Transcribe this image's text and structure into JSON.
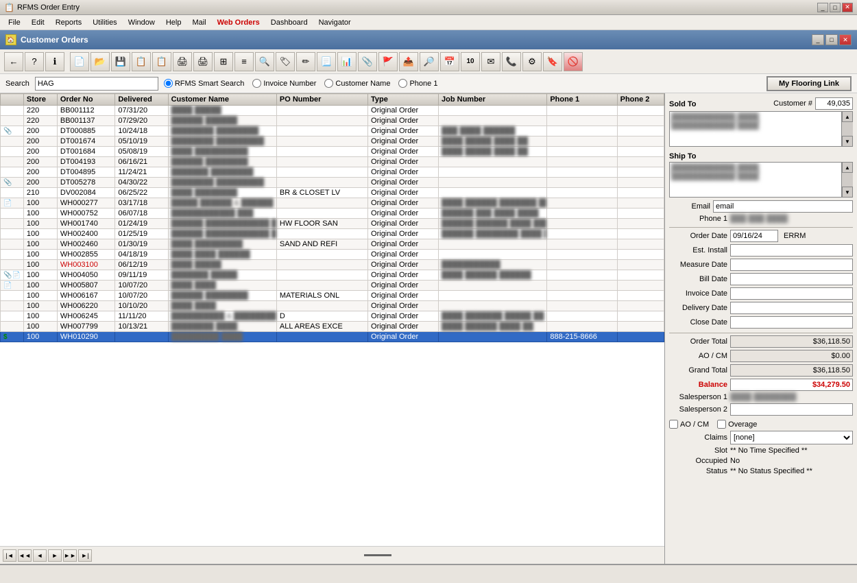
{
  "titleBar": {
    "title": "RFMS Order Entry",
    "buttons": [
      "_",
      "□",
      "✕"
    ]
  },
  "menuBar": {
    "items": [
      {
        "label": "File",
        "highlight": false
      },
      {
        "label": "Edit",
        "highlight": false
      },
      {
        "label": "Reports",
        "highlight": false
      },
      {
        "label": "Utilities",
        "highlight": false
      },
      {
        "label": "Window",
        "highlight": false
      },
      {
        "label": "Help",
        "highlight": false
      },
      {
        "label": "Mail",
        "highlight": false
      },
      {
        "label": "Web Orders",
        "highlight": true
      },
      {
        "label": "Dashboard",
        "highlight": false
      },
      {
        "label": "Navigator",
        "highlight": false
      }
    ]
  },
  "appTitleBar": {
    "title": "Customer Orders",
    "buttons": [
      "_",
      "□",
      "✕"
    ]
  },
  "search": {
    "label": "Search",
    "value": "HAG",
    "placeholder": "",
    "radioOptions": [
      {
        "label": "RFMS Smart Search",
        "checked": true
      },
      {
        "label": "Invoice Number",
        "checked": false
      },
      {
        "label": "Customer Name",
        "checked": false
      },
      {
        "label": "Phone 1",
        "checked": false
      }
    ],
    "myFlooringBtn": "My Flooring Link"
  },
  "grid": {
    "columns": [
      "",
      "Store",
      "Order No",
      "Delivered",
      "Customer Name",
      "PO Number",
      "Type",
      "Job Number",
      "Phone 1",
      "Phone 2"
    ],
    "rows": [
      {
        "icons": "",
        "store": "220",
        "orderNo": "BB001112",
        "delivered": "07/31/20",
        "customer": "████ █████",
        "po": "",
        "type": "Original Order",
        "job": "",
        "phone1": "",
        "phone2": "",
        "selected": false,
        "red": false
      },
      {
        "icons": "",
        "store": "220",
        "orderNo": "BB001137",
        "delivered": "07/29/20",
        "customer": "██████ ██████",
        "po": "",
        "type": "Original Order",
        "job": "",
        "phone1": "",
        "phone2": "",
        "selected": false,
        "red": false
      },
      {
        "icons": "📎",
        "store": "200",
        "orderNo": "DT000885",
        "delivered": "10/24/18",
        "customer": "████████ ████████",
        "po": "",
        "type": "Original Order",
        "job": "███ ████ ██████",
        "phone1": "",
        "phone2": "",
        "selected": false,
        "red": false
      },
      {
        "icons": "",
        "store": "200",
        "orderNo": "DT001674",
        "delivered": "05/10/19",
        "customer": "████████ █████████",
        "po": "",
        "type": "Original Order",
        "job": "████ █████ ████ ██",
        "phone1": "",
        "phone2": "",
        "selected": false,
        "red": false
      },
      {
        "icons": "",
        "store": "200",
        "orderNo": "DT001684",
        "delivered": "05/08/19",
        "customer": "████ ██████████",
        "po": "",
        "type": "Original Order",
        "job": "████ █████ ████ ██",
        "phone1": "",
        "phone2": "",
        "selected": false,
        "red": false
      },
      {
        "icons": "",
        "store": "200",
        "orderNo": "DT004193",
        "delivered": "06/16/21",
        "customer": "██████ ████████",
        "po": "",
        "type": "Original Order",
        "job": "",
        "phone1": "",
        "phone2": "",
        "selected": false,
        "red": false
      },
      {
        "icons": "",
        "store": "200",
        "orderNo": "DT004895",
        "delivered": "11/24/21",
        "customer": "███████ ████████",
        "po": "",
        "type": "Original Order",
        "job": "",
        "phone1": "",
        "phone2": "",
        "selected": false,
        "red": false
      },
      {
        "icons": "📎",
        "store": "200",
        "orderNo": "DT005278",
        "delivered": "04/30/22",
        "customer": "████████ █████████",
        "po": "",
        "type": "Original Order",
        "job": "",
        "phone1": "",
        "phone2": "",
        "selected": false,
        "red": false
      },
      {
        "icons": "",
        "store": "210",
        "orderNo": "DV002084",
        "delivered": "06/25/22",
        "customer": "████ ████████",
        "po": "BR & CLOSET LV",
        "type": "Original Order",
        "job": "",
        "phone1": "",
        "phone2": "",
        "selected": false,
        "red": false
      },
      {
        "icons": "📄",
        "store": "100",
        "orderNo": "WH000277",
        "delivered": "03/17/18",
        "customer": "█████ ██████ & ██████",
        "po": "",
        "type": "Original Order",
        "job": "████ ██████ ███████ ██",
        "phone1": "",
        "phone2": "",
        "selected": false,
        "red": false
      },
      {
        "icons": "",
        "store": "100",
        "orderNo": "WH000752",
        "delivered": "06/07/18",
        "customer": "████████████ ███",
        "po": "",
        "type": "Original Order",
        "job": "██████ ███ ████ ████",
        "phone1": "",
        "phone2": "",
        "selected": false,
        "red": false
      },
      {
        "icons": "",
        "store": "100",
        "orderNo": "WH001740",
        "delivered": "01/24/19",
        "customer": "██████ ████████████ ██",
        "po": "HW FLOOR SAN",
        "type": "Original Order",
        "job": "██████ ██████ ████ ████",
        "phone1": "",
        "phone2": "",
        "selected": false,
        "red": false
      },
      {
        "icons": "",
        "store": "100",
        "orderNo": "WH002400",
        "delivered": "01/25/19",
        "customer": "██████ ████████████ ██",
        "po": "",
        "type": "Original Order",
        "job": "██████ ████████ ████ ████",
        "phone1": "",
        "phone2": "",
        "selected": false,
        "red": false
      },
      {
        "icons": "",
        "store": "100",
        "orderNo": "WH002460",
        "delivered": "01/30/19",
        "customer": "████ █████████",
        "po": "SAND AND REFI",
        "type": "Original Order",
        "job": "",
        "phone1": "",
        "phone2": "",
        "selected": false,
        "red": false
      },
      {
        "icons": "",
        "store": "100",
        "orderNo": "WH002855",
        "delivered": "04/18/19",
        "customer": "████ ████ ██████",
        "po": "",
        "type": "Original Order",
        "job": "",
        "phone1": "",
        "phone2": "",
        "selected": false,
        "red": false
      },
      {
        "icons": "",
        "store": "100",
        "orderNo": "WH003100",
        "delivered": "06/12/19",
        "customer": "████ █████",
        "po": "",
        "type": "Original Order",
        "job": "███████████",
        "phone1": "",
        "phone2": "",
        "selected": false,
        "red": true
      },
      {
        "icons": "📎📄",
        "store": "100",
        "orderNo": "WH004050",
        "delivered": "09/11/19",
        "customer": "███████ █████",
        "po": "",
        "type": "Original Order",
        "job": "████ ██████ ██████",
        "phone1": "",
        "phone2": "",
        "selected": false,
        "red": false
      },
      {
        "icons": "📄",
        "store": "100",
        "orderNo": "WH005807",
        "delivered": "10/07/20",
        "customer": "████ ████",
        "po": "",
        "type": "Original Order",
        "job": "",
        "phone1": "",
        "phone2": "",
        "selected": false,
        "red": false
      },
      {
        "icons": "",
        "store": "100",
        "orderNo": "WH006167",
        "delivered": "10/07/20",
        "customer": "██████ ████████",
        "po": "MATERIALS ONL",
        "type": "Original Order",
        "job": "",
        "phone1": "",
        "phone2": "",
        "selected": false,
        "red": false
      },
      {
        "icons": "",
        "store": "100",
        "orderNo": "WH006220",
        "delivered": "10/10/20",
        "customer": "████ ████",
        "po": "",
        "type": "Original Order",
        "job": "",
        "phone1": "",
        "phone2": "",
        "selected": false,
        "red": false
      },
      {
        "icons": "",
        "store": "100",
        "orderNo": "WH006245",
        "delivered": "11/11/20",
        "customer": "██████████ & ████████",
        "po": "D",
        "type": "Original Order",
        "job": "████ ███████ █████ ██",
        "phone1": "",
        "phone2": "",
        "selected": false,
        "red": false
      },
      {
        "icons": "",
        "store": "100",
        "orderNo": "WH007799",
        "delivered": "10/13/21",
        "customer": "████████ ████",
        "po": "ALL AREAS EXCE",
        "type": "Original Order",
        "job": "████ ██████ ████ ██",
        "phone1": "",
        "phone2": "",
        "selected": false,
        "red": false
      },
      {
        "icons": "💲",
        "store": "100",
        "orderNo": "WH010290",
        "delivered": "",
        "customer": "█████████ ████",
        "po": "",
        "type": "Original Order",
        "job": "",
        "phone1": "888-215-8666",
        "phone2": "",
        "selected": true,
        "red": false,
        "hasDollar": true
      }
    ]
  },
  "rightPanel": {
    "soldToLabel": "Sold To",
    "customerNumLabel": "Customer #",
    "customerNum": "49,035",
    "soldToAddress": "████████████ ████\n████████████ ████",
    "shipToLabel": "Ship To",
    "shipToAddress": "████████████ ████\n████████████ ████",
    "emailLabel": "Email",
    "emailValue": "email",
    "phone1Label": "Phone 1",
    "phone1Value": "███ ███ ████",
    "orderDateLabel": "Order Date",
    "orderDateValue": "09/16/24",
    "orderDateSuffix": "ERRM",
    "estInstallLabel": "Est. Install",
    "estInstallValue": "",
    "measureDateLabel": "Measure Date",
    "measureDateValue": "",
    "billDateLabel": "Bill Date",
    "billDateValue": "",
    "invoiceDateLabel": "Invoice Date",
    "invoiceDateValue": "",
    "deliveryDateLabel": "Delivery Date",
    "deliveryDateValue": "",
    "closeDateLabel": "Close Date",
    "closeDateValue": "",
    "orderTotalLabel": "Order Total",
    "orderTotalValue": "$36,118.50",
    "aoCmLabel": "AO / CM",
    "aoCmValue": "$0.00",
    "grandTotalLabel": "Grand Total",
    "grandTotalValue": "$36,118.50",
    "balanceLabel": "Balance",
    "balanceValue": "$34,279.50",
    "salesperson1Label": "Salesperson 1",
    "salesperson1Value": "████ ████████",
    "salesperson2Label": "Salesperson 2",
    "salesperson2Value": "",
    "aoCmCheckLabel": "AO / CM",
    "overageCheckLabel": "Overage",
    "claimsLabel": "Claims",
    "claimsValue": "[none]",
    "slotLabel": "Slot",
    "slotValue": "** No Time Specified **",
    "occupiedLabel": "Occupied",
    "occupiedValue": "No",
    "statusLabel": "Status",
    "statusValue": "** No Status Specified **"
  },
  "navBar": {
    "buttons": [
      "|◄",
      "◄◄",
      "◄",
      "►",
      "►►",
      "►|"
    ]
  }
}
